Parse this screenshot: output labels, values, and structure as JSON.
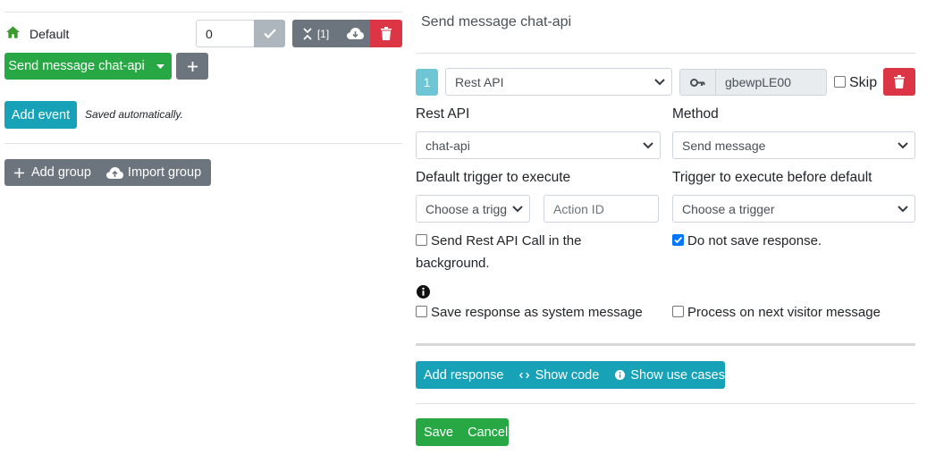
{
  "left": {
    "default_label": "Default",
    "priority_value": "0",
    "collapse_counter": "[1]",
    "trigger_button_label": "Send message chat-api",
    "add_event_label": "Add event",
    "saved_text": "Saved automatically.",
    "add_group_label": "Add group",
    "import_group_label": "Import group"
  },
  "right": {
    "title": "Send message chat-api",
    "step_number": "1",
    "action_type": "Rest API",
    "action_id_value": "gbewpLE00",
    "skip_label": "Skip",
    "rest_api_label": "Rest API",
    "rest_api_value": "chat-api",
    "method_label": "Method",
    "method_value": "Send message",
    "default_trigger_label": "Default trigger to execute",
    "default_trigger_value": "Choose a trigg",
    "action_id_placeholder": "Action ID",
    "before_trigger_label": "Trigger to execute before default",
    "before_trigger_value": "Choose a trigger",
    "background_label_line1": "Send Rest API Call in the",
    "background_label_line2": "background.",
    "background_checked": false,
    "no_save_label": "Do not save response.",
    "no_save_checked": true,
    "system_message_label": "Save response as system message",
    "system_message_checked": false,
    "next_visitor_label": "Process on next visitor message",
    "next_visitor_checked": false,
    "add_response_label": "Add response",
    "show_code_label": "Show code",
    "show_use_cases_label": "Show use cases",
    "save_label": "Save",
    "cancel_label": "Cancel"
  },
  "colors": {
    "green": "#28a745",
    "gray": "#6c757d",
    "teal": "#17a2b8",
    "red": "#dc3545",
    "step_badge": "#6ec6d4",
    "home_icon": "#3c9a2e"
  }
}
